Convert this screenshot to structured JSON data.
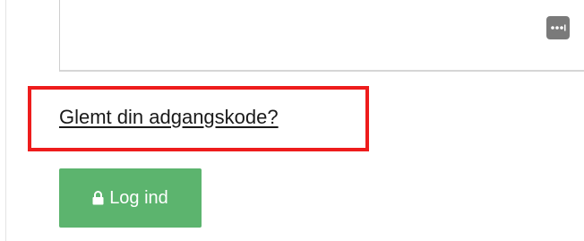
{
  "form": {
    "forgot_password_link": "Glemt din adgangskode?",
    "login_button_label": "Log ind"
  },
  "icons": {
    "password_manager": "password-manager-icon",
    "login_lock": "lock-icon"
  },
  "colors": {
    "login_button": "#5cb46e",
    "highlight_border": "#ee1c1c",
    "password_manager_icon": "#7a7a7a"
  }
}
